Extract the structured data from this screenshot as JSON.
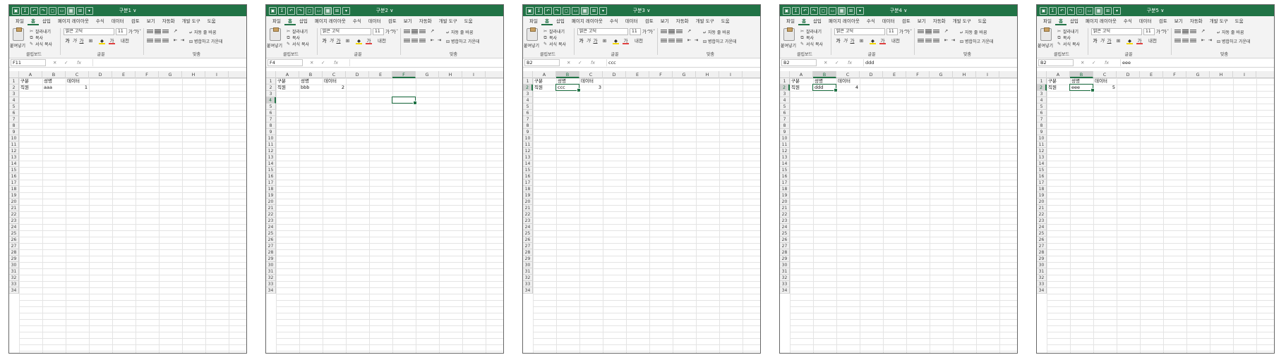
{
  "ribbon_tabs": [
    "파일",
    "홈",
    "삽입",
    "페이지 레이아웃",
    "수식",
    "데이터",
    "검토",
    "보기",
    "자동화",
    "개발 도구",
    "도움"
  ],
  "active_tab": "홈",
  "clipboard": {
    "paste": "붙여넣기",
    "cut": "잘라내기",
    "copy": "복사",
    "format_painter": "서식 복사",
    "group_label": "클립보드"
  },
  "font": {
    "name": "맑은 고딕",
    "size": "11",
    "grow": "가^",
    "shrink": "가ˇ",
    "bold": "가",
    "italic": "가",
    "underline": "가",
    "color_glyph": "가",
    "phonetic": "내천",
    "group_label": "글꼴"
  },
  "alignment": {
    "wrap_text": "자동 줄 바꿈",
    "merge_center": "병합하고 가운데",
    "group_label": "맞춤"
  },
  "columns": [
    "A",
    "B",
    "C",
    "D",
    "E",
    "F",
    "G",
    "H",
    "I"
  ],
  "rows": [
    "1",
    "2",
    "3",
    "4",
    "5",
    "6",
    "7",
    "8",
    "9",
    "10",
    "11",
    "12",
    "13",
    "14",
    "15",
    "16",
    "17",
    "18",
    "19",
    "20",
    "21",
    "22",
    "23",
    "24",
    "25",
    "26",
    "27",
    "28",
    "29",
    "30",
    "31",
    "32",
    "33",
    "34"
  ],
  "header_row": {
    "a": "구분",
    "b": "성명",
    "c": "데이터"
  },
  "colors": {
    "accent": "#217346"
  },
  "windows": [
    {
      "title": "구분1 ∨",
      "namebox": "F11",
      "formula": "",
      "a2": "직원",
      "b2": "aaa",
      "c2": "1",
      "selected_col": "",
      "selected_row": ""
    },
    {
      "title": "구분2 ∨",
      "namebox": "F4",
      "formula": "",
      "a2": "직원",
      "b2": "bbb",
      "c2": "2",
      "selected_col": "F",
      "selected_row": "4"
    },
    {
      "title": "구분3 ∨",
      "namebox": "B2",
      "formula": "ccc",
      "a2": "직원",
      "b2": "ccc",
      "c2": "3",
      "selected_col": "B",
      "selected_row": "2"
    },
    {
      "title": "구분4 ∨",
      "namebox": "B2",
      "formula": "ddd",
      "a2": "직원",
      "b2": "ddd",
      "c2": "4",
      "selected_col": "B",
      "selected_row": "2"
    },
    {
      "title": "구분5 ∨",
      "namebox": "B2",
      "formula": "eee",
      "a2": "직원",
      "b2": "eee",
      "c2": "5",
      "selected_col": "B",
      "selected_row": "2"
    }
  ]
}
